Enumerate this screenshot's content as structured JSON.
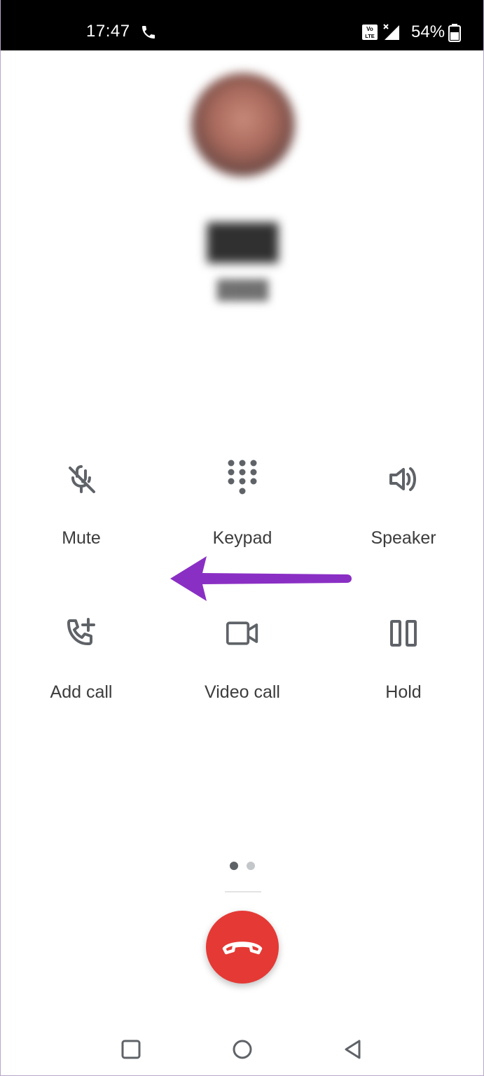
{
  "status_bar": {
    "time": "17:47",
    "battery": "54%",
    "icons": [
      "call-icon",
      "volte-icon",
      "signal-icon",
      "battery-icon"
    ]
  },
  "contact": {
    "avatar": "contact-avatar"
  },
  "controls": [
    {
      "label": "Mute",
      "icon": "mic-off-icon"
    },
    {
      "label": "Keypad",
      "icon": "dialpad-icon"
    },
    {
      "label": "Speaker",
      "icon": "speaker-icon"
    },
    {
      "label": "Add call",
      "icon": "add-call-icon"
    },
    {
      "label": "Video call",
      "icon": "video-call-icon"
    },
    {
      "label": "Hold",
      "icon": "pause-icon"
    }
  ],
  "annotation": {
    "icon": "arrow-left-icon",
    "color": "#8a2fc4"
  },
  "pager": {
    "current_page": 1,
    "total_pages": 2
  },
  "end_call": {
    "icon": "call-end-icon",
    "color": "#e53935"
  },
  "nav": [
    "recents-icon",
    "home-icon",
    "back-icon"
  ]
}
